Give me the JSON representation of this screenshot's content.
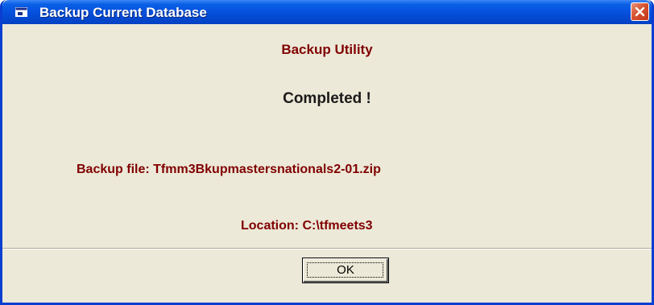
{
  "window": {
    "title": "Backup Current Database",
    "close_icon": "close-x-icon",
    "app_icon": "window-app-icon"
  },
  "content": {
    "heading": "Backup Utility",
    "status": "Completed !",
    "file_line": "Backup file: Tfmm3Bkupmastersnationals2-01.zip",
    "location_line": "Location: C:\\tfmeets3"
  },
  "buttons": {
    "ok_label": "OK"
  },
  "colors": {
    "titlebar": "#0551de",
    "accent_text": "#800000",
    "face": "#ece9d8"
  }
}
